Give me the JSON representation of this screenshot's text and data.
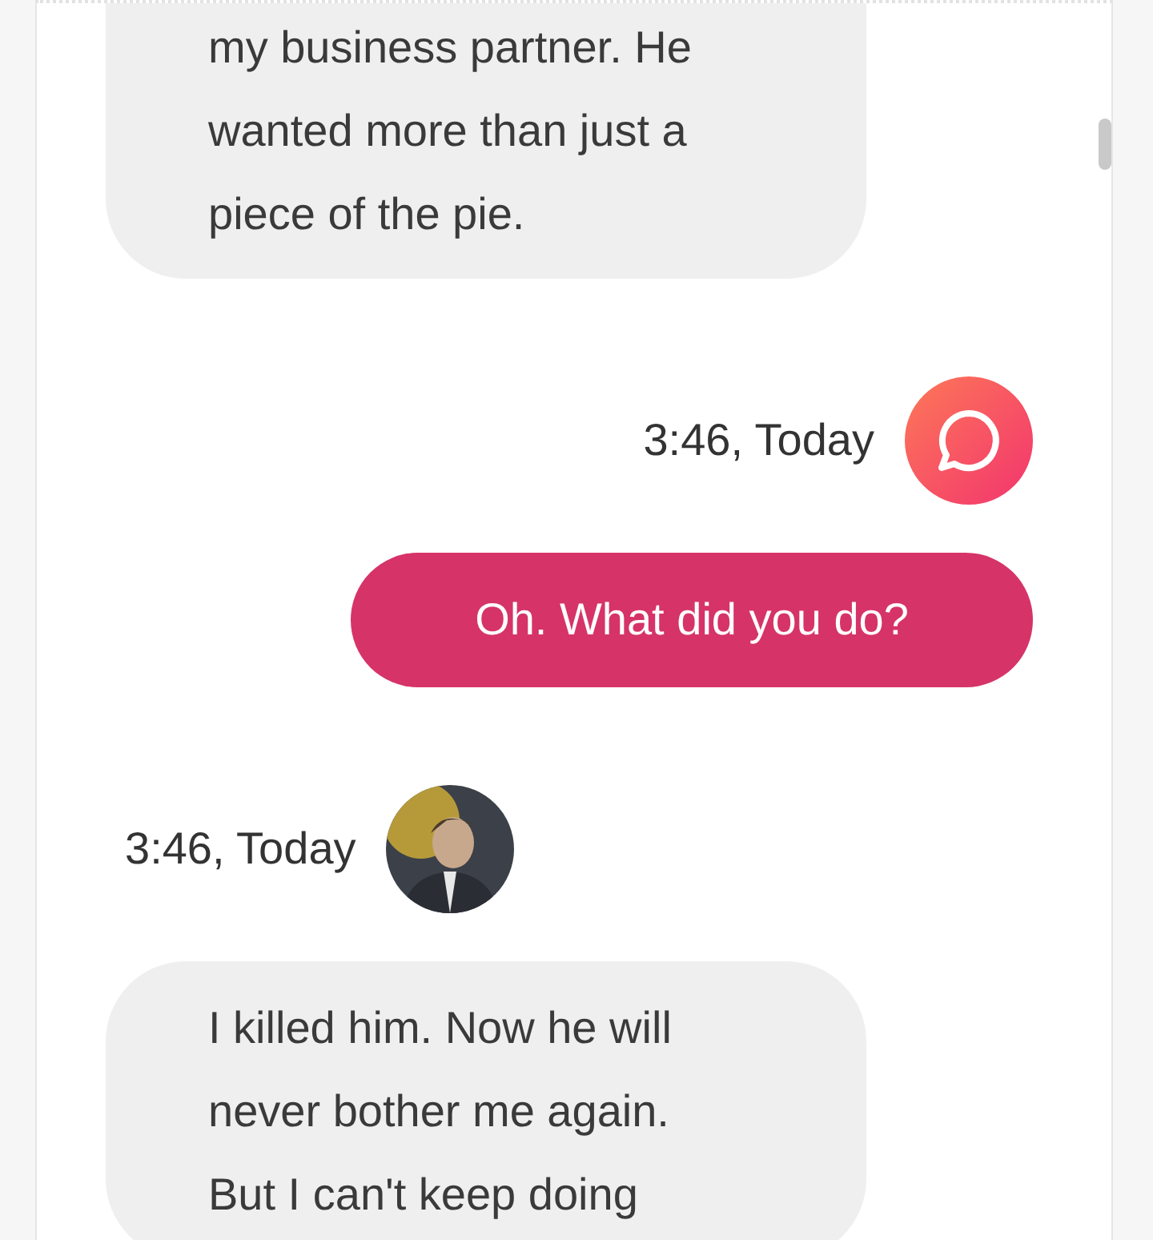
{
  "messages": [
    {
      "kind": "bot",
      "lines": [
        "my business partner. He",
        "wanted more than just a",
        "piece of the pie."
      ]
    },
    {
      "kind": "user",
      "time": "3:46, Today",
      "lines": [
        "Oh. What did you do?"
      ]
    },
    {
      "kind": "bot",
      "time": "3:46, Today",
      "lines": [
        "I killed him. Now he will",
        "never bother me again.",
        "But I can't keep doing"
      ]
    }
  ]
}
